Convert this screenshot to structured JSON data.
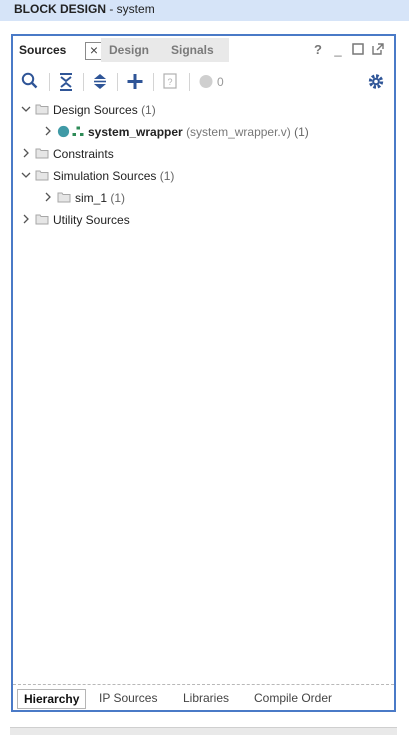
{
  "title": {
    "bold": "BLOCK DESIGN",
    "rest": " - system"
  },
  "tabs": [
    {
      "label": "Sources",
      "active": true
    },
    {
      "label": "Design",
      "active": false
    },
    {
      "label": "Signals",
      "active": false
    }
  ],
  "window_controls": {
    "help": "?",
    "minimize": "_",
    "maximize": "□"
  },
  "toolbar": {
    "status_count": "0"
  },
  "tree": [
    {
      "label": "Design Sources",
      "count": "(1)",
      "expanded": true
    },
    {
      "label": "system_wrapper",
      "sub": "(system_wrapper.v)",
      "count": "(1)"
    },
    {
      "label": "Constraints"
    },
    {
      "label": "Simulation Sources",
      "count": "(1)",
      "expanded": true
    },
    {
      "label": "sim_1",
      "count": "(1)"
    },
    {
      "label": "Utility Sources"
    }
  ],
  "bottom_tabs": [
    {
      "label": "Hierarchy",
      "active": true
    },
    {
      "label": "IP Sources"
    },
    {
      "label": "Libraries"
    },
    {
      "label": "Compile Order"
    }
  ],
  "colors": {
    "accent": "#4a7ac7",
    "title_bg": "#d6e4f8",
    "toolbar_icon": "#2f5597"
  }
}
